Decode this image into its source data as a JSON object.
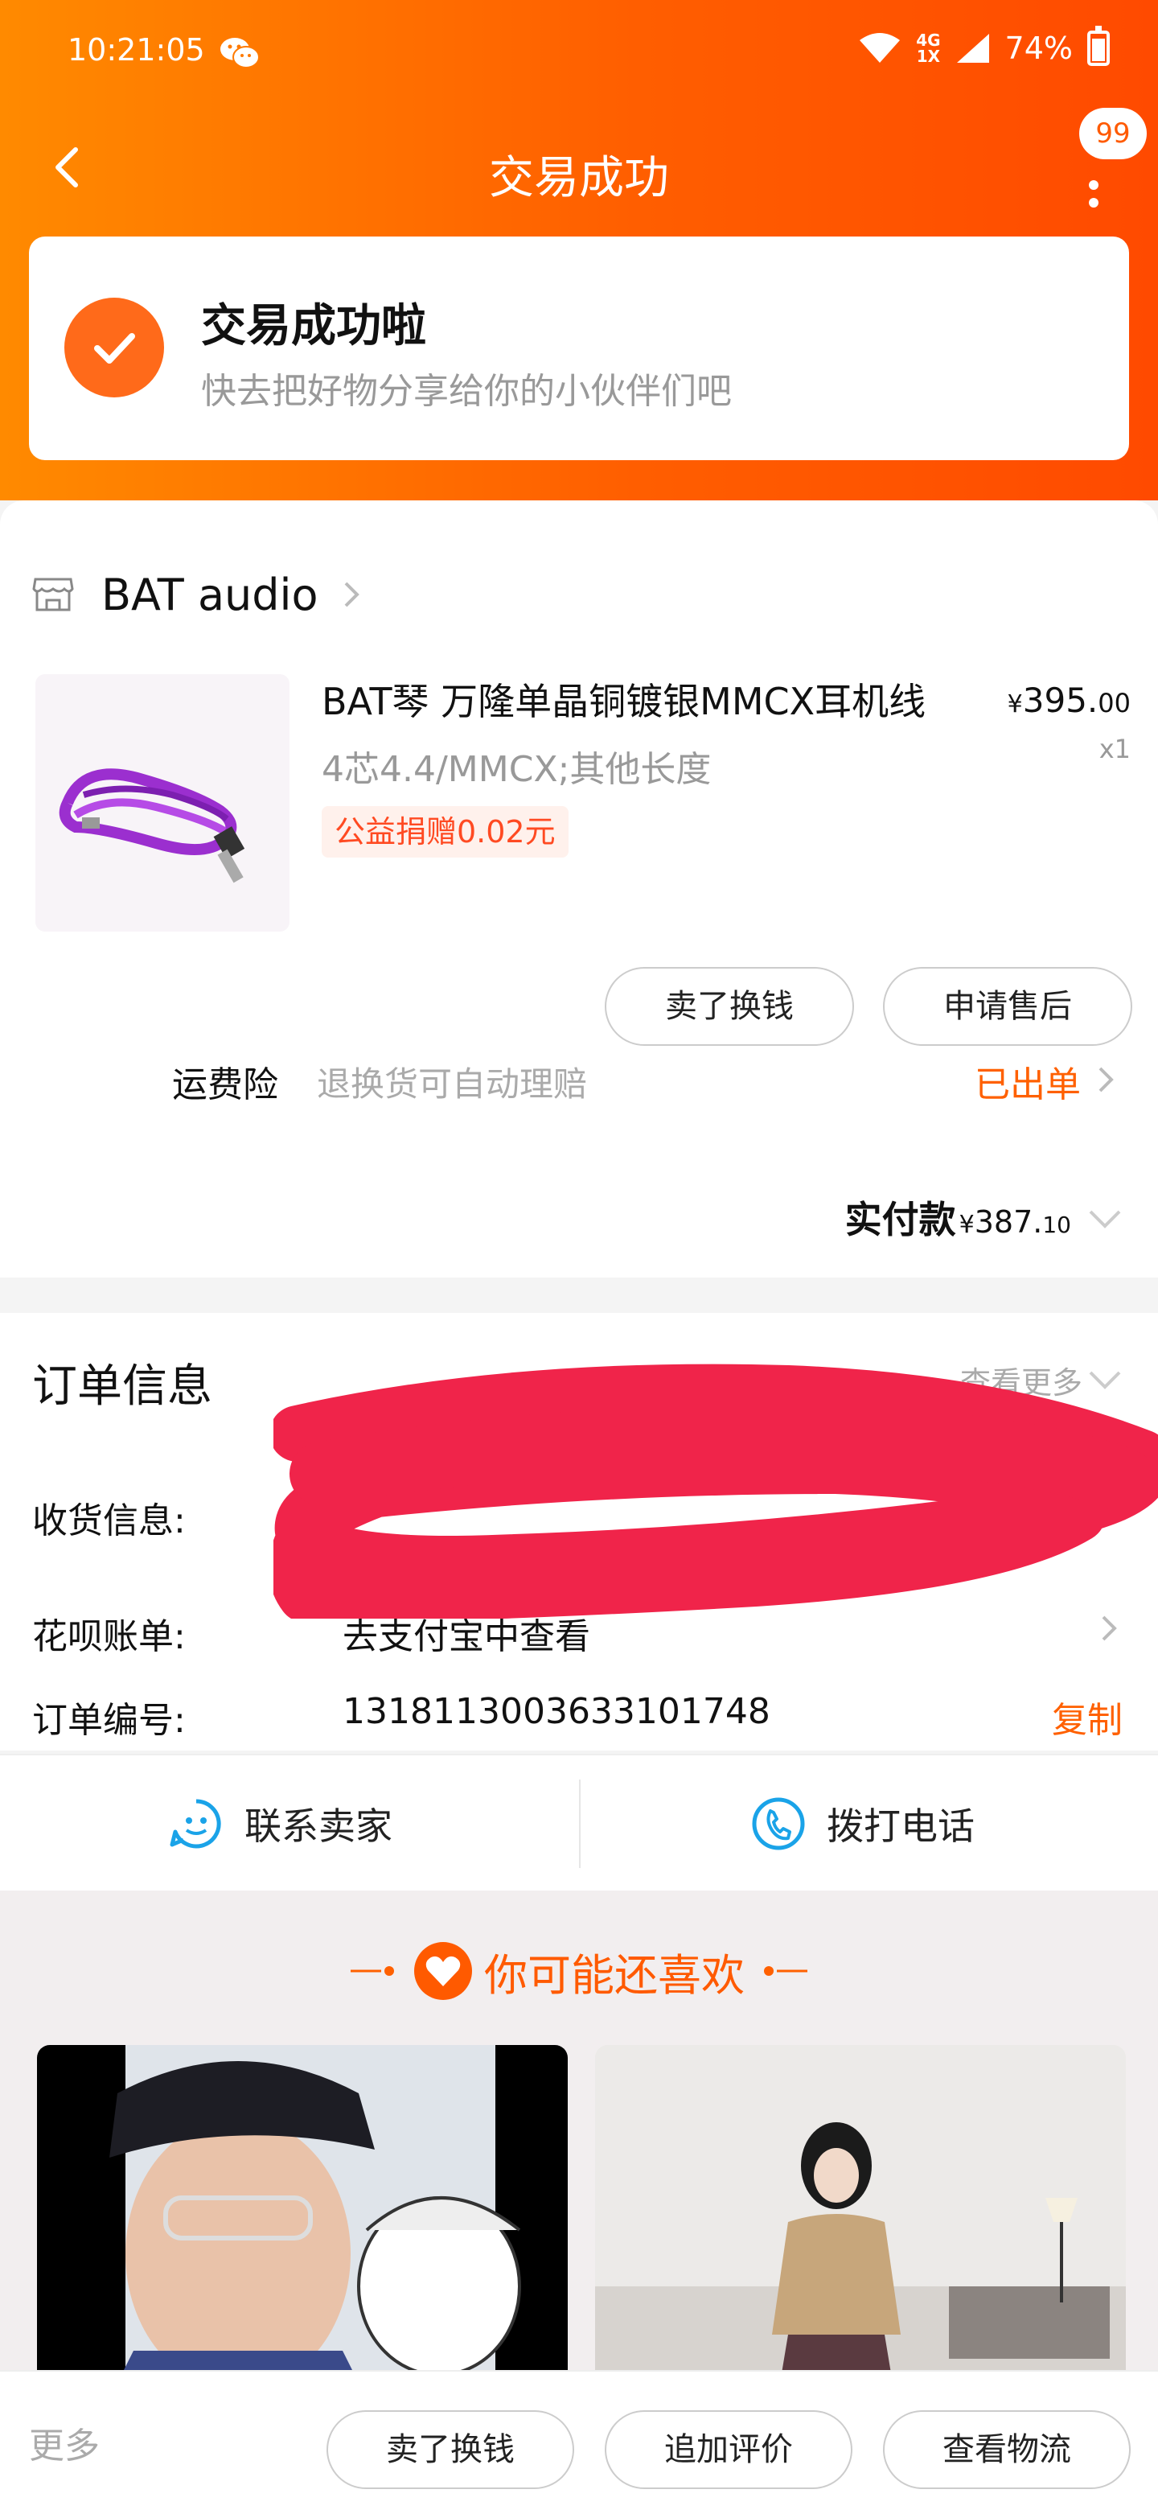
{
  "status_bar": {
    "time": "10:21:05",
    "network_top": "4G",
    "network_bottom": "1X",
    "battery": "74%"
  },
  "nav": {
    "title": "交易成功",
    "badge": "99"
  },
  "success": {
    "title": "交易成功啦",
    "subtitle": "快去把好物分享给你的小伙伴们吧"
  },
  "store": {
    "name": "BAT audio",
    "product": {
      "title": "BAT琴 万隆单晶铜镀银MMCX耳机线",
      "spec": "4芯4.4/MMCX;其他长度",
      "donation": "公益捐赠0.02元",
      "price_symbol": "¥",
      "price_int": "395.",
      "price_dec": "00",
      "qty": "x1"
    },
    "buttons": {
      "sell": "卖了换钱",
      "after_sale": "申请售后"
    },
    "freight": {
      "label": "运费险",
      "desc": "退换货可自动理赔",
      "status": "已出单"
    },
    "paid": {
      "label": "实付款",
      "symbol": "¥",
      "amount_int": "387.",
      "amount_dec": "10"
    }
  },
  "order": {
    "heading": "订单信息",
    "view_more": "查看更多",
    "shipping_label": "收货信息:",
    "huabei_label": "花呗账单:",
    "huabei_value": "去支付宝中查看",
    "order_no_label": "订单编号:",
    "order_no_value": "1318113003633101748",
    "copy": "复制"
  },
  "contact": {
    "seller": "联系卖家",
    "call": "拨打电话"
  },
  "recommend": {
    "title": "你可能还喜欢"
  },
  "bottom": {
    "more": "更多",
    "sell": "卖了换钱",
    "review": "追加评价",
    "logistics": "查看物流"
  },
  "colors": {
    "accent": "#ff6000",
    "header_gradient_start": "#ff8a00",
    "header_gradient_end": "#ff4a00",
    "donation_text": "#ff4a22",
    "contact_icon": "#1aa3e8"
  }
}
